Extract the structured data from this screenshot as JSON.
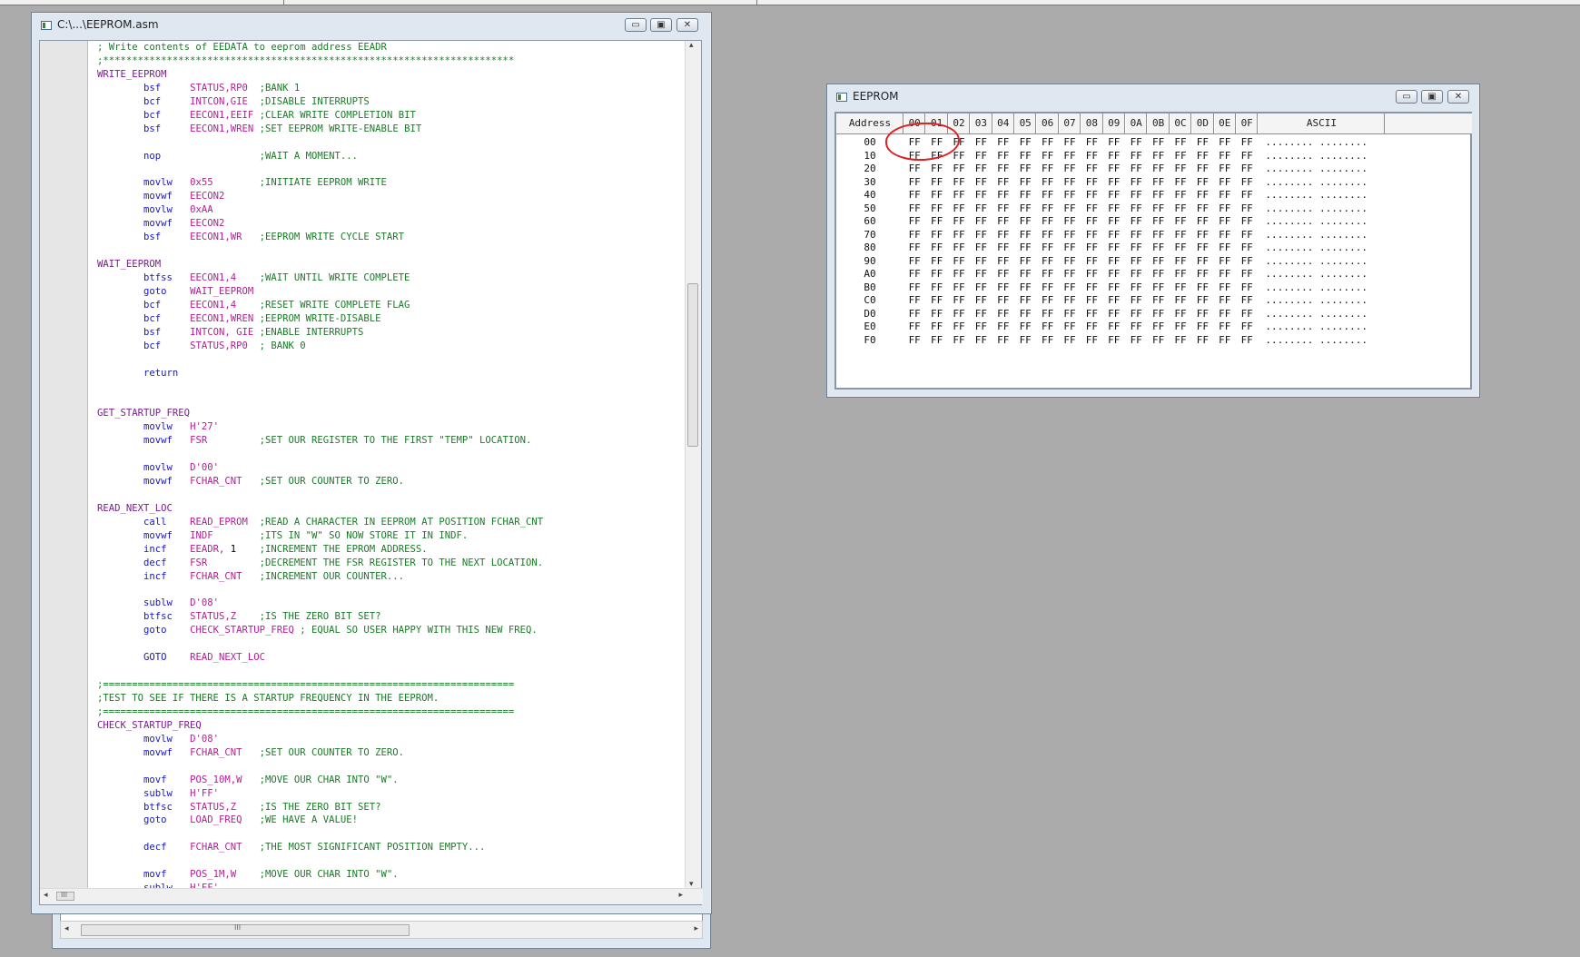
{
  "editor": {
    "title": "C:\\...\\EEPROM.asm",
    "lines": [
      [
        {
          "t": "; Write contents of EEDATA to eeprom address EEADR",
          "c": "cmt"
        }
      ],
      [
        {
          "t": ";***********************************************************************",
          "c": "cmt"
        }
      ],
      [
        {
          "t": "WRITE_EEPROM",
          "c": "lbl"
        }
      ],
      [
        {
          "t": "        "
        },
        {
          "t": "bsf",
          "c": "ins"
        },
        {
          "t": "     "
        },
        {
          "t": "STATUS,RP0",
          "c": "opr"
        },
        {
          "t": "  "
        },
        {
          "t": ";BANK 1",
          "c": "cmt"
        }
      ],
      [
        {
          "t": "        "
        },
        {
          "t": "bcf",
          "c": "ins"
        },
        {
          "t": "     "
        },
        {
          "t": "INTCON,GIE",
          "c": "opr"
        },
        {
          "t": "  "
        },
        {
          "t": ";DISABLE INTERRUPTS",
          "c": "cmt"
        }
      ],
      [
        {
          "t": "        "
        },
        {
          "t": "bcf",
          "c": "ins"
        },
        {
          "t": "     "
        },
        {
          "t": "EECON1,EEIF",
          "c": "opr"
        },
        {
          "t": " "
        },
        {
          "t": ";CLEAR WRITE COMPLETION BIT",
          "c": "cmt"
        }
      ],
      [
        {
          "t": "        "
        },
        {
          "t": "bsf",
          "c": "ins"
        },
        {
          "t": "     "
        },
        {
          "t": "EECON1,WREN",
          "c": "opr"
        },
        {
          "t": " "
        },
        {
          "t": ";SET EEPROM WRITE-ENABLE BIT",
          "c": "cmt"
        }
      ],
      [],
      [
        {
          "t": "        "
        },
        {
          "t": "nop",
          "c": "ins"
        },
        {
          "t": "                 "
        },
        {
          "t": ";WAIT A MOMENT...",
          "c": "cmt"
        }
      ],
      [],
      [
        {
          "t": "        "
        },
        {
          "t": "movlw",
          "c": "ins"
        },
        {
          "t": "   "
        },
        {
          "t": "0x55",
          "c": "opr"
        },
        {
          "t": "        "
        },
        {
          "t": ";INITIATE EEPROM WRITE",
          "c": "cmt"
        }
      ],
      [
        {
          "t": "        "
        },
        {
          "t": "movwf",
          "c": "ins"
        },
        {
          "t": "   "
        },
        {
          "t": "EECON2",
          "c": "opr"
        }
      ],
      [
        {
          "t": "        "
        },
        {
          "t": "movlw",
          "c": "ins"
        },
        {
          "t": "   "
        },
        {
          "t": "0xAA",
          "c": "opr"
        }
      ],
      [
        {
          "t": "        "
        },
        {
          "t": "movwf",
          "c": "ins"
        },
        {
          "t": "   "
        },
        {
          "t": "EECON2",
          "c": "opr"
        }
      ],
      [
        {
          "t": "        "
        },
        {
          "t": "bsf",
          "c": "ins"
        },
        {
          "t": "     "
        },
        {
          "t": "EECON1,WR",
          "c": "opr"
        },
        {
          "t": "   "
        },
        {
          "t": ";EEPROM WRITE CYCLE START",
          "c": "cmt"
        }
      ],
      [],
      [
        {
          "t": "WAIT_EEPROM",
          "c": "lbl"
        }
      ],
      [
        {
          "t": "        "
        },
        {
          "t": "btfss",
          "c": "ins"
        },
        {
          "t": "   "
        },
        {
          "t": "EECON1,4",
          "c": "opr"
        },
        {
          "t": "    "
        },
        {
          "t": ";WAIT UNTIL WRITE COMPLETE",
          "c": "cmt"
        }
      ],
      [
        {
          "t": "        "
        },
        {
          "t": "goto",
          "c": "ins"
        },
        {
          "t": "    "
        },
        {
          "t": "WAIT_EEPROM",
          "c": "opr"
        }
      ],
      [
        {
          "t": "        "
        },
        {
          "t": "bcf",
          "c": "ins"
        },
        {
          "t": "     "
        },
        {
          "t": "EECON1,4",
          "c": "opr"
        },
        {
          "t": "    "
        },
        {
          "t": ";RESET WRITE COMPLETE FLAG",
          "c": "cmt"
        }
      ],
      [
        {
          "t": "        "
        },
        {
          "t": "bcf",
          "c": "ins"
        },
        {
          "t": "     "
        },
        {
          "t": "EECON1,WREN",
          "c": "opr"
        },
        {
          "t": " "
        },
        {
          "t": ";EEPROM WRITE-DISABLE",
          "c": "cmt"
        }
      ],
      [
        {
          "t": "        "
        },
        {
          "t": "bsf",
          "c": "ins"
        },
        {
          "t": "     "
        },
        {
          "t": "INTCON, GIE",
          "c": "opr"
        },
        {
          "t": " "
        },
        {
          "t": ";ENABLE INTERRUPTS",
          "c": "cmt"
        }
      ],
      [
        {
          "t": "        "
        },
        {
          "t": "bcf",
          "c": "ins"
        },
        {
          "t": "     "
        },
        {
          "t": "STATUS,RP0",
          "c": "opr"
        },
        {
          "t": "  "
        },
        {
          "t": "; BANK 0",
          "c": "cmt"
        }
      ],
      [],
      [
        {
          "t": "        "
        },
        {
          "t": "return",
          "c": "ins"
        }
      ],
      [],
      [],
      [
        {
          "t": "GET_STARTUP_FREQ",
          "c": "lbl"
        }
      ],
      [
        {
          "t": "        "
        },
        {
          "t": "movlw",
          "c": "ins"
        },
        {
          "t": "   "
        },
        {
          "t": "H'27'",
          "c": "opr"
        }
      ],
      [
        {
          "t": "        "
        },
        {
          "t": "movwf",
          "c": "ins"
        },
        {
          "t": "   "
        },
        {
          "t": "FSR",
          "c": "opr"
        },
        {
          "t": "         "
        },
        {
          "t": ";SET OUR REGISTER TO THE FIRST \"TEMP\" LOCATION.",
          "c": "cmt"
        }
      ],
      [],
      [
        {
          "t": "        "
        },
        {
          "t": "movlw",
          "c": "ins"
        },
        {
          "t": "   "
        },
        {
          "t": "D'00'",
          "c": "opr"
        }
      ],
      [
        {
          "t": "        "
        },
        {
          "t": "movwf",
          "c": "ins"
        },
        {
          "t": "   "
        },
        {
          "t": "FCHAR_CNT",
          "c": "opr"
        },
        {
          "t": "   "
        },
        {
          "t": ";SET OUR COUNTER TO ZERO.",
          "c": "cmt"
        }
      ],
      [],
      [
        {
          "t": "READ_NEXT_LOC",
          "c": "lbl"
        }
      ],
      [
        {
          "t": "        "
        },
        {
          "t": "call",
          "c": "ins"
        },
        {
          "t": "    "
        },
        {
          "t": "READ_EPROM",
          "c": "opr"
        },
        {
          "t": "  "
        },
        {
          "t": ";READ A CHARACTER IN EEPROM AT POSITION FCHAR_CNT",
          "c": "cmt"
        }
      ],
      [
        {
          "t": "        "
        },
        {
          "t": "movwf",
          "c": "ins"
        },
        {
          "t": "   "
        },
        {
          "t": "INDF",
          "c": "opr"
        },
        {
          "t": "        "
        },
        {
          "t": ";ITS IN \"W\" SO NOW STORE IT IN INDF.",
          "c": "cmt"
        }
      ],
      [
        {
          "t": "        "
        },
        {
          "t": "incf",
          "c": "ins"
        },
        {
          "t": "    "
        },
        {
          "t": "EEADR,",
          "c": "opr"
        },
        {
          "t": " 1    "
        },
        {
          "t": ";INCREMENT THE EPROM ADDRESS.",
          "c": "cmt"
        }
      ],
      [
        {
          "t": "        "
        },
        {
          "t": "decf",
          "c": "ins"
        },
        {
          "t": "    "
        },
        {
          "t": "FSR",
          "c": "opr"
        },
        {
          "t": "         "
        },
        {
          "t": ";DECREMENT THE FSR REGISTER TO THE NEXT LOCATION.",
          "c": "cmt"
        }
      ],
      [
        {
          "t": "        "
        },
        {
          "t": "incf",
          "c": "ins"
        },
        {
          "t": "    "
        },
        {
          "t": "FCHAR_CNT",
          "c": "opr"
        },
        {
          "t": "   "
        },
        {
          "t": ";INCREMENT OUR COUNTER...",
          "c": "cmt"
        }
      ],
      [],
      [
        {
          "t": "        "
        },
        {
          "t": "sublw",
          "c": "ins"
        },
        {
          "t": "   "
        },
        {
          "t": "D'08'",
          "c": "opr"
        }
      ],
      [
        {
          "t": "        "
        },
        {
          "t": "btfsc",
          "c": "ins"
        },
        {
          "t": "   "
        },
        {
          "t": "STATUS,Z",
          "c": "opr"
        },
        {
          "t": "    "
        },
        {
          "t": ";IS THE ZERO BIT SET?",
          "c": "cmt"
        }
      ],
      [
        {
          "t": "        "
        },
        {
          "t": "goto",
          "c": "ins"
        },
        {
          "t": "    "
        },
        {
          "t": "CHECK_STARTUP_FREQ",
          "c": "opr"
        },
        {
          "t": " "
        },
        {
          "t": "; EQUAL SO USER HAPPY WITH THIS NEW FREQ.",
          "c": "cmt"
        }
      ],
      [],
      [
        {
          "t": "        "
        },
        {
          "t": "GOTO",
          "c": "ins"
        },
        {
          "t": "    "
        },
        {
          "t": "READ_NEXT_LOC",
          "c": "opr"
        }
      ],
      [],
      [
        {
          "t": ";=======================================================================",
          "c": "cmt"
        }
      ],
      [
        {
          "t": ";TEST TO SEE IF THERE IS A STARTUP FREQUENCY IN THE EEPROM.",
          "c": "cmt"
        }
      ],
      [
        {
          "t": ";=======================================================================",
          "c": "cmt"
        }
      ],
      [
        {
          "t": "CHECK_STARTUP_FREQ",
          "c": "lbl"
        }
      ],
      [
        {
          "t": "        "
        },
        {
          "t": "movlw",
          "c": "ins"
        },
        {
          "t": "   "
        },
        {
          "t": "D'08'",
          "c": "opr"
        }
      ],
      [
        {
          "t": "        "
        },
        {
          "t": "movwf",
          "c": "ins"
        },
        {
          "t": "   "
        },
        {
          "t": "FCHAR_CNT",
          "c": "opr"
        },
        {
          "t": "   "
        },
        {
          "t": ";SET OUR COUNTER TO ZERO.",
          "c": "cmt"
        }
      ],
      [],
      [
        {
          "t": "        "
        },
        {
          "t": "movf",
          "c": "ins"
        },
        {
          "t": "    "
        },
        {
          "t": "POS_10M,W",
          "c": "opr"
        },
        {
          "t": "   "
        },
        {
          "t": ";MOVE OUR CHAR INTO \"W\".",
          "c": "cmt"
        }
      ],
      [
        {
          "t": "        "
        },
        {
          "t": "sublw",
          "c": "ins"
        },
        {
          "t": "   "
        },
        {
          "t": "H'FF'",
          "c": "opr"
        }
      ],
      [
        {
          "t": "        "
        },
        {
          "t": "btfsc",
          "c": "ins"
        },
        {
          "t": "   "
        },
        {
          "t": "STATUS,Z",
          "c": "opr"
        },
        {
          "t": "    "
        },
        {
          "t": ";IS THE ZERO BIT SET?",
          "c": "cmt"
        }
      ],
      [
        {
          "t": "        "
        },
        {
          "t": "goto",
          "c": "ins"
        },
        {
          "t": "    "
        },
        {
          "t": "LOAD_FREQ",
          "c": "opr"
        },
        {
          "t": "   "
        },
        {
          "t": ";WE HAVE A VALUE!",
          "c": "cmt"
        }
      ],
      [],
      [
        {
          "t": "        "
        },
        {
          "t": "decf",
          "c": "ins"
        },
        {
          "t": "    "
        },
        {
          "t": "FCHAR_CNT",
          "c": "opr"
        },
        {
          "t": "   "
        },
        {
          "t": ";THE MOST SIGNIFICANT POSITION EMPTY...",
          "c": "cmt"
        }
      ],
      [],
      [
        {
          "t": "        "
        },
        {
          "t": "movf",
          "c": "ins"
        },
        {
          "t": "    "
        },
        {
          "t": "POS_1M,W",
          "c": "opr"
        },
        {
          "t": "    "
        },
        {
          "t": ";MOVE OUR CHAR INTO \"W\".",
          "c": "cmt"
        }
      ],
      [
        {
          "t": "        "
        },
        {
          "t": "sublw",
          "c": "ins"
        },
        {
          "t": "   "
        },
        {
          "t": "H'FF'",
          "c": "opr"
        }
      ]
    ]
  },
  "eeprom": {
    "title": "EEPROM",
    "columns": [
      "Address",
      "00",
      "01",
      "02",
      "03",
      "04",
      "05",
      "06",
      "07",
      "08",
      "09",
      "0A",
      "0B",
      "0C",
      "0D",
      "0E",
      "0F",
      "ASCII"
    ],
    "rows": [
      {
        "addr": "00",
        "ascii": "........ ........"
      },
      {
        "addr": "10",
        "ascii": "........ ........"
      },
      {
        "addr": "20",
        "ascii": "........ ........"
      },
      {
        "addr": "30",
        "ascii": "........ ........"
      },
      {
        "addr": "40",
        "ascii": "........ ........"
      },
      {
        "addr": "50",
        "ascii": "........ ........"
      },
      {
        "addr": "60",
        "ascii": "........ ........"
      },
      {
        "addr": "70",
        "ascii": "........ ........"
      },
      {
        "addr": "80",
        "ascii": "........ ........"
      },
      {
        "addr": "90",
        "ascii": "........ ........"
      },
      {
        "addr": "A0",
        "ascii": "........ ........"
      },
      {
        "addr": "B0",
        "ascii": "........ ........"
      },
      {
        "addr": "C0",
        "ascii": "........ ........"
      },
      {
        "addr": "D0",
        "ascii": "........ ........"
      },
      {
        "addr": "E0",
        "ascii": "........ ........"
      },
      {
        "addr": "F0",
        "ascii": "........ ........"
      }
    ],
    "cell_value": "FF"
  },
  "window_buttons": {
    "minimize": "▭",
    "maximize": "▣",
    "close": "✕"
  },
  "scroll": {
    "grip": "III",
    "left": "◂",
    "right": "▸",
    "up": "▴",
    "down": "▾"
  },
  "colors": {
    "label": "#7a1d8f",
    "instruction": "#1717c4",
    "operand": "#b01f93",
    "comment": "#1b7a28",
    "annotation_ring": "#e02020"
  }
}
